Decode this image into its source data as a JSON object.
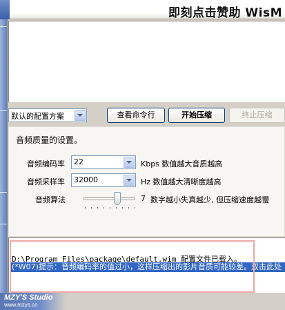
{
  "banner": {
    "title": "即刻点击赞助 WisM"
  },
  "top_panel": {},
  "profile": {
    "selected": "默认的配置方案"
  },
  "buttons": {
    "view_cmd": "查看命令行",
    "start": "开始压缩",
    "stop": "终止压缩"
  },
  "settings": {
    "title": "音频质量的设置。",
    "bitrate": {
      "label": "音频编码率",
      "value": "22",
      "note": "Kbps 数值越大音质越高"
    },
    "samplerate": {
      "label": "音频采样率",
      "value": "32000",
      "note": "Hz 数值越大清晰度越高"
    },
    "algorithm": {
      "label": "音频算法",
      "value": 7,
      "value_text": "7",
      "note": "数字越小失真越少, 但压缩速度越慢"
    }
  },
  "log": {
    "line1_path": "D:\\Program Files\\package\\default.wim",
    "line1_msg": "配置文件已载入。",
    "line2": "(*W07)提示：音频编码率的值过小，这样压缩出的影片音质可能较差。双击此处"
  },
  "watermark": {
    "title": "MZY'S Studio",
    "url": "www.mzys.cn"
  },
  "colors": {
    "selection": "#3166c4",
    "highlight_box": "#f0a8a8",
    "face": "#d4d0c8"
  }
}
